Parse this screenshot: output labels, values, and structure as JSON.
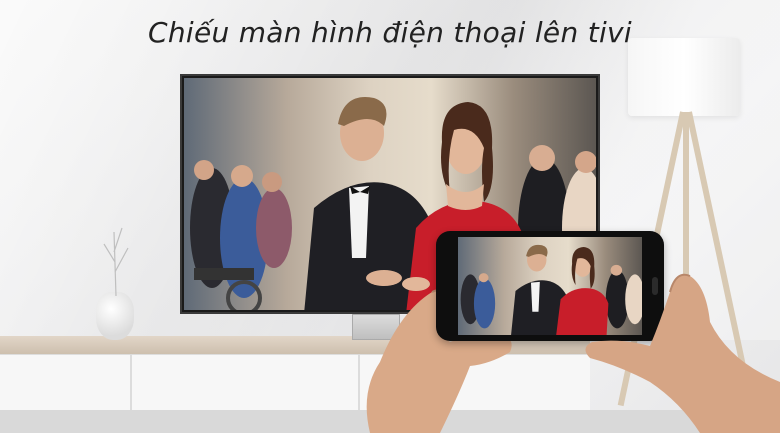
{
  "headline": "Chiếu màn hình điện thoại lên tivi",
  "colors": {
    "accent_dress": "#c81e2a",
    "suit": "#1f1f24",
    "wall": "#eeeeee",
    "cabinet_top": "#d8c9b8"
  },
  "icons": {
    "tv": "tv-icon",
    "phone": "smartphone-icon",
    "lamp": "floor-lamp-icon",
    "vase": "vase-icon"
  }
}
